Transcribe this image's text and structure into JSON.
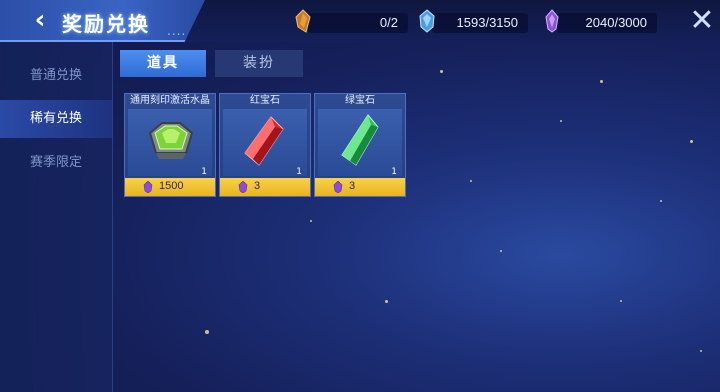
{
  "header": {
    "title": "奖励兑换",
    "title_suffix": "....",
    "back_icon": "chevron-left-icon",
    "close_icon": "close-icon"
  },
  "resources": [
    {
      "icon": "crystal-shard-icon",
      "value": "0/2"
    },
    {
      "icon": "blue-gem-icon",
      "value": "1593/3150"
    },
    {
      "icon": "purple-gem-icon",
      "value": "2040/3000"
    }
  ],
  "sidebar": {
    "items": [
      {
        "label": "普通兑换",
        "active": false
      },
      {
        "label": "稀有兑换",
        "active": true
      },
      {
        "label": "赛季限定",
        "active": false
      }
    ]
  },
  "tabs": [
    {
      "label": "道具",
      "active": true
    },
    {
      "label": "装扮",
      "active": false
    }
  ],
  "items": [
    {
      "name": "通用刻印激活水晶",
      "icon": "green-hexagon-gem-icon",
      "count": "1",
      "price": "1500"
    },
    {
      "name": "红宝石",
      "icon": "red-crystal-icon",
      "count": "1",
      "price": "3"
    },
    {
      "name": "绿宝石",
      "icon": "green-crystal-icon",
      "count": "1",
      "price": "3"
    }
  ],
  "colors": {
    "accent": "#3f7de3",
    "price_bar": "#f2c43a",
    "background": "#15205a"
  }
}
